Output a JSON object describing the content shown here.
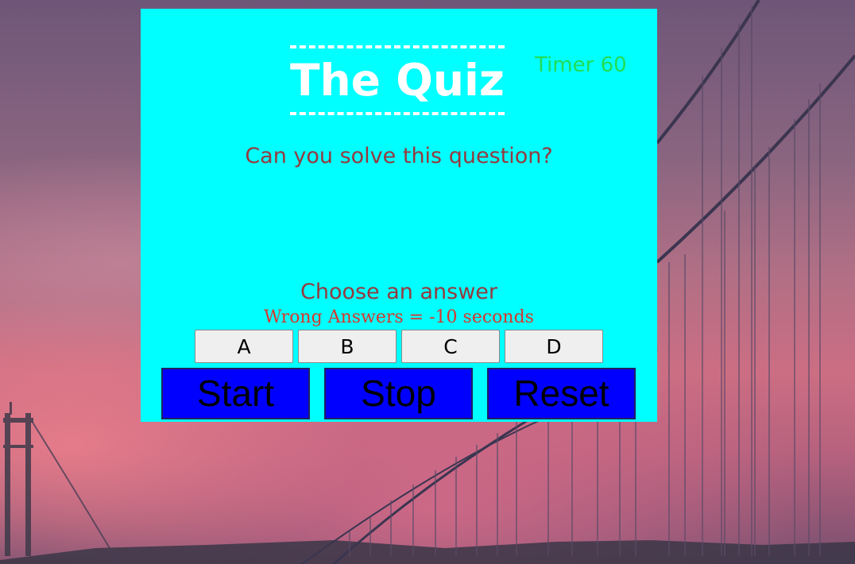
{
  "quiz": {
    "title": "The Quiz",
    "timer_text": "Timer 60",
    "question": "Can you solve this question?",
    "prompt": "Choose an answer",
    "penalty_note": "Wrong Answers = -10 seconds",
    "answers": [
      "A",
      "B",
      "C",
      "D"
    ],
    "controls": {
      "start": "Start",
      "stop": "Stop",
      "reset": "Reset"
    }
  },
  "colors": {
    "panel_background": "#00ffff",
    "title_text": "#ffffff",
    "timer_text": "#22dd55",
    "question_text": "#953a3f",
    "penalty_text": "#d8362d",
    "control_button_background": "#0000ff",
    "answer_button_background": "#efefef"
  },
  "background": {
    "icon": "suspension-bridge-sunset-photo"
  }
}
